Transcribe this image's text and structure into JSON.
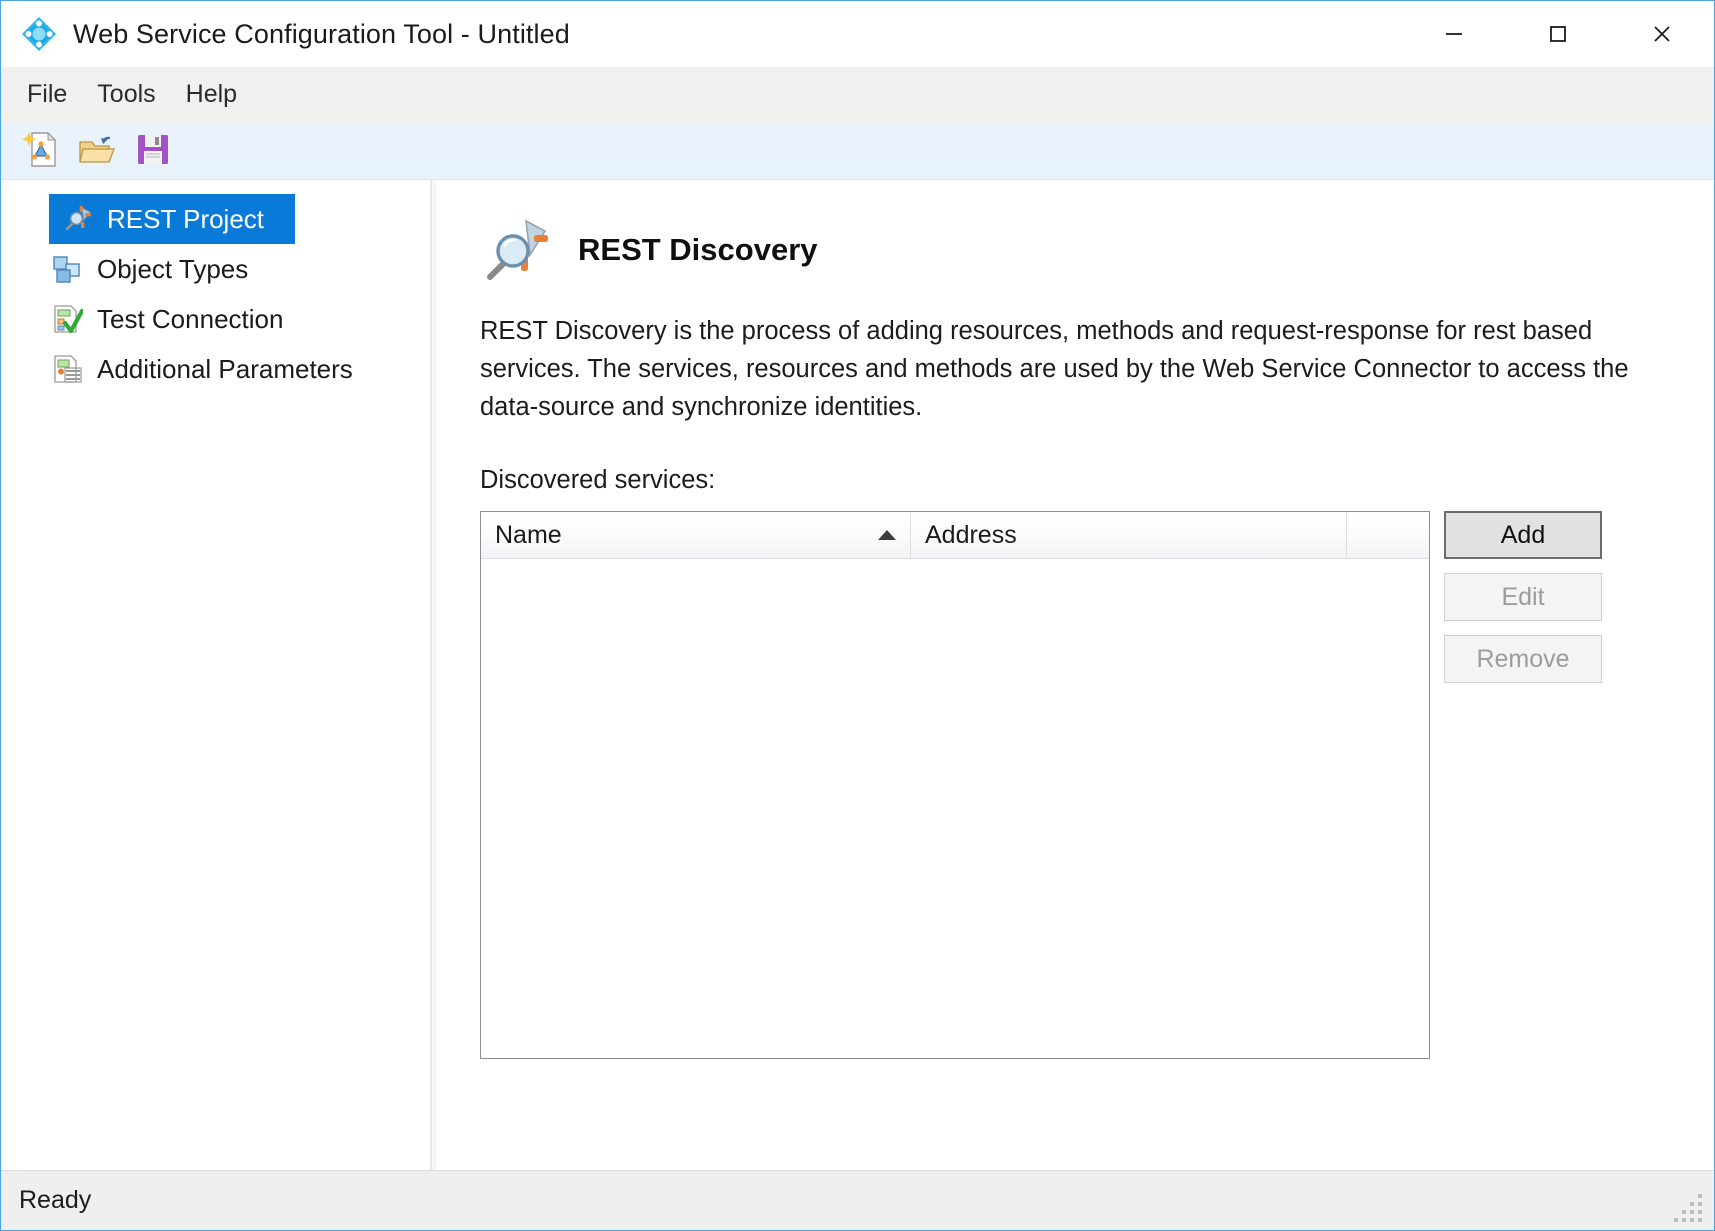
{
  "window": {
    "title": "Web Service Configuration Tool - Untitled",
    "app_icon": "diamond-app-icon",
    "minimize_label": "–",
    "maximize_label": "□",
    "close_label": "✕"
  },
  "menubar": {
    "items": [
      {
        "label": "File"
      },
      {
        "label": "Tools"
      },
      {
        "label": "Help"
      }
    ]
  },
  "toolbar": {
    "buttons": [
      {
        "name": "new-project-icon",
        "tooltip": "New"
      },
      {
        "name": "open-project-icon",
        "tooltip": "Open"
      },
      {
        "name": "save-project-icon",
        "tooltip": "Save"
      }
    ]
  },
  "sidebar": {
    "items": [
      {
        "label": "REST Project",
        "icon": "rest-project-icon",
        "selected": true
      },
      {
        "label": "Object Types",
        "icon": "object-types-icon",
        "selected": false
      },
      {
        "label": "Test Connection",
        "icon": "test-connection-icon",
        "selected": false
      },
      {
        "label": "Additional Parameters",
        "icon": "additional-parameters-icon",
        "selected": false
      }
    ]
  },
  "content": {
    "heading": "REST Discovery",
    "heading_icon": "rest-discovery-magnifier-icon",
    "description": "REST Discovery is the process of adding resources, methods and request-response for rest based services. The services, resources and methods are used by the Web Service Connector to access the data-source and synchronize identities.",
    "list_label": "Discovered services:",
    "table": {
      "columns": [
        {
          "label": "Name",
          "sorted": "asc"
        },
        {
          "label": "Address",
          "sorted": "none"
        },
        {
          "label": "",
          "sorted": "none"
        }
      ],
      "rows": []
    },
    "buttons": [
      {
        "label": "Add",
        "enabled": true
      },
      {
        "label": "Edit",
        "enabled": false
      },
      {
        "label": "Remove",
        "enabled": false
      }
    ]
  },
  "statusbar": {
    "message": "Ready"
  },
  "colors": {
    "selection_blue": "#0a7ad8",
    "toolbar_blue": "#eaf3fb",
    "menu_gray": "#f0f0ee",
    "status_gray": "#efefef",
    "window_border": "#4aa3e8"
  }
}
